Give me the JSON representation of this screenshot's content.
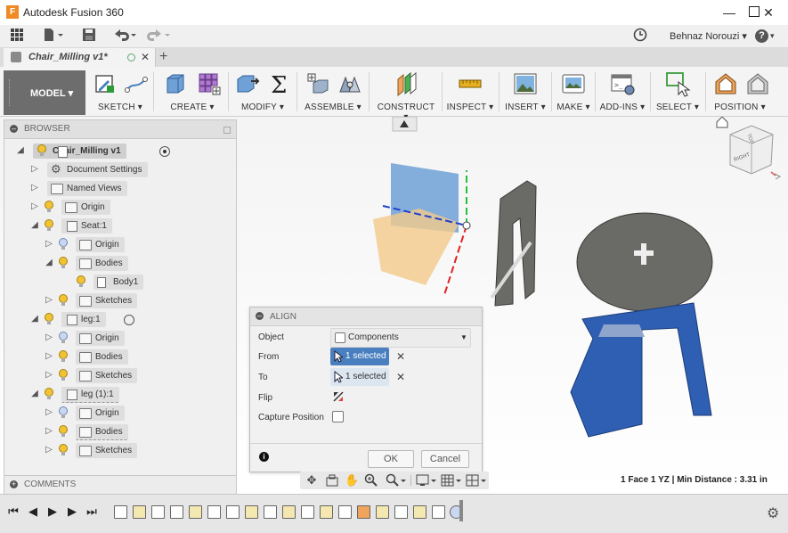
{
  "window": {
    "title": "Autodesk Fusion 360",
    "app_icon": "F"
  },
  "appbar": {
    "user": "Behnaz Norouzi ▾",
    "help": "? ▾"
  },
  "document_tab": {
    "label": "Chair_Milling v1*"
  },
  "workspace": {
    "label": "MODEL ▾"
  },
  "ribbon": {
    "groups": [
      {
        "label": "SKETCH ▾"
      },
      {
        "label": "CREATE ▾"
      },
      {
        "label": "MODIFY ▾"
      },
      {
        "label": "ASSEMBLE ▾"
      },
      {
        "label": "CONSTRUCT ▾"
      },
      {
        "label": "INSPECT ▾"
      },
      {
        "label": "INSERT ▾"
      },
      {
        "label": "MAKE ▾"
      },
      {
        "label": "ADD-INS ▾"
      },
      {
        "label": "SELECT ▾"
      },
      {
        "label": "POSITION ▾"
      }
    ]
  },
  "browser": {
    "title": "BROWSER",
    "nodes": [
      {
        "label": "Chair_Milling v1"
      },
      {
        "label": "Document Settings"
      },
      {
        "label": "Named Views"
      },
      {
        "label": "Origin"
      },
      {
        "label": "Seat:1"
      },
      {
        "label": "Origin"
      },
      {
        "label": "Bodies"
      },
      {
        "label": "Body1"
      },
      {
        "label": "Sketches"
      },
      {
        "label": "leg:1"
      },
      {
        "label": "Origin"
      },
      {
        "label": "Bodies"
      },
      {
        "label": "Sketches"
      },
      {
        "label": "leg (1):1"
      },
      {
        "label": "Origin"
      },
      {
        "label": "Bodies"
      },
      {
        "label": "Sketches"
      }
    ]
  },
  "comments": {
    "title": "COMMENTS"
  },
  "align_dialog": {
    "title": "ALIGN",
    "object_label": "Object",
    "object_value": "Components",
    "from_label": "From",
    "from_value": "1 selected",
    "to_label": "To",
    "to_value": "1 selected",
    "flip_label": "Flip",
    "capture_label": "Capture Position",
    "ok_label": "OK",
    "cancel_label": "Cancel",
    "info": "i"
  },
  "viewcube": {
    "face_front": "RIGHT",
    "face_top": "TOP"
  },
  "status": {
    "text": "1 Face 1 YZ | Min Distance : 3.31 in"
  },
  "colors": {
    "accent_blue": "#4a7fbf",
    "part_gray": "#6a6a67",
    "part_blue": "#2f5fb3",
    "plane_blue": "#6fa1d6",
    "plane_orange": "#f3c98b"
  }
}
